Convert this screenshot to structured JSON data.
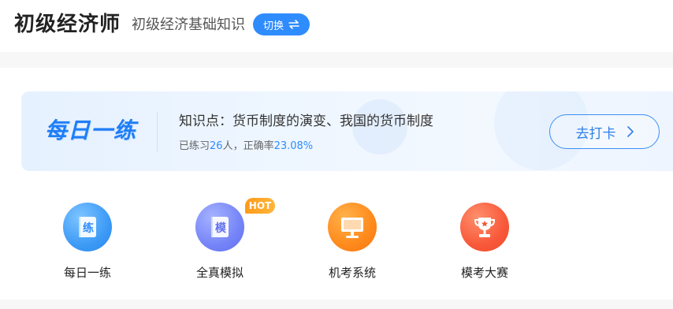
{
  "header": {
    "exam_title": "初级经济师",
    "subject_name": "初级经济基础知识",
    "switch_label": "切换"
  },
  "daily_practice": {
    "logo_text": "每日一练",
    "knowledge_label": "知识点：",
    "knowledge_topics": "货币制度的演变、我国的货币制度",
    "stats_prefix": "已练习",
    "practiced_count": "26",
    "stats_mid": "人，正确率",
    "accuracy": "23.08%",
    "checkin_label": "去打卡"
  },
  "features": [
    {
      "label": "每日一练",
      "icon_char": "练",
      "icon": "book-practice-icon"
    },
    {
      "label": "全真模拟",
      "icon_char": "模",
      "icon": "book-mock-icon",
      "badge": "HOT"
    },
    {
      "label": "机考系统",
      "icon": "computer-monitor-icon"
    },
    {
      "label": "模考大赛",
      "icon": "trophy-icon"
    }
  ],
  "colors": {
    "accent": "#2f8cff",
    "hot_badge": "#ff9a1a"
  }
}
